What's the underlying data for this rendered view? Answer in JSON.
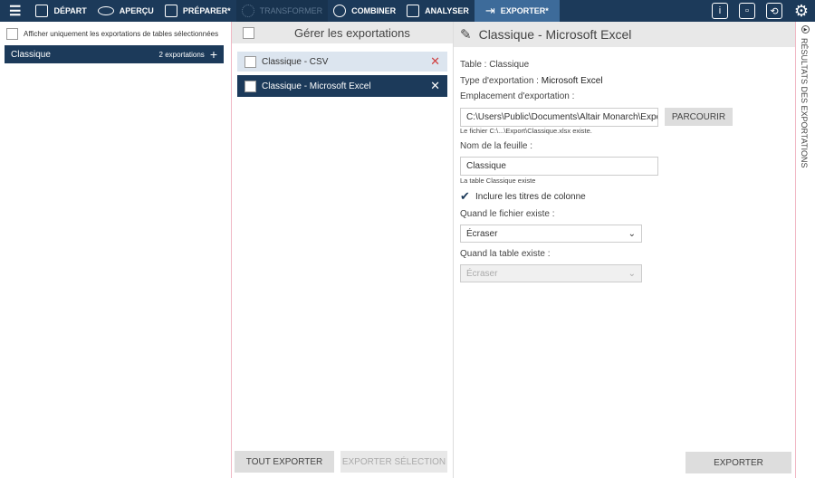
{
  "nav": {
    "tabs": [
      {
        "label": "DÉPART",
        "icon": "cube-icon"
      },
      {
        "label": "APERÇU",
        "icon": "eye-icon"
      },
      {
        "label": "PRÉPARER*",
        "icon": "table-icon"
      },
      {
        "label": "TRANSFORMER",
        "icon": "transform-icon"
      },
      {
        "label": "COMBINER",
        "icon": "combine-icon"
      },
      {
        "label": "ANALYSER",
        "icon": "clipboard-icon"
      },
      {
        "label": "EXPORTER*",
        "icon": "export-arrow-icon"
      }
    ],
    "info": "i"
  },
  "left": {
    "filter_label": "Afficher uniquement les exportations de tables sélectionnées",
    "group": {
      "name": "Classique",
      "count": "2 exportations"
    }
  },
  "mid": {
    "title": "Gérer les exportations",
    "items": [
      "Classique - CSV",
      "Classique - Microsoft Excel"
    ],
    "export_all": "TOUT EXPORTER",
    "export_selection": "EXPORTER SÉLECTION"
  },
  "main": {
    "title": "Classique - Microsoft Excel",
    "table": "Table : Classique",
    "type_label": "Type d'exportation :",
    "type_value": "Microsoft Excel",
    "location_label": "Emplacement d'exportation :",
    "location_value": "C:\\Users\\Public\\Documents\\Altair Monarch\\Export",
    "browse": "PARCOURIR",
    "file_exists": "Le fichier C:\\...\\Export\\Classique.xlsx existe.",
    "sheet_label": "Nom de la feuille :",
    "sheet_value": "Classique",
    "table_exists_note": "La table Classique existe",
    "include_headers": "Inclure les titres de colonne",
    "file_exists_label": "Quand le fichier existe :",
    "file_exists_value": "Écraser",
    "table_exists_label": "Quand la table existe :",
    "table_exists_value": "Écraser",
    "export": "EXPORTER"
  },
  "side": {
    "label": "RÉSULTATS DES EXPORTATIONS"
  }
}
